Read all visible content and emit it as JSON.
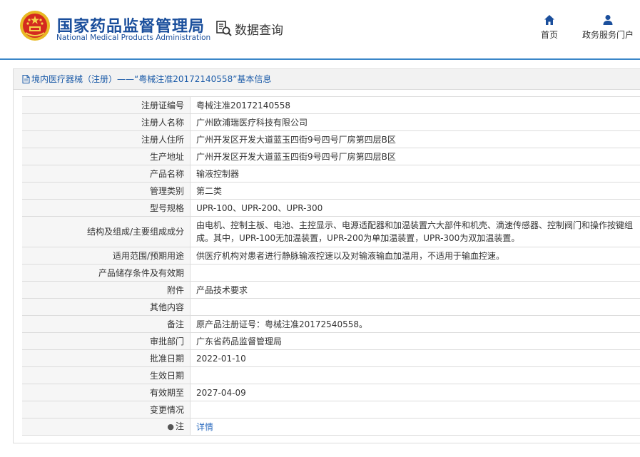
{
  "header": {
    "org_name_cn": "国家药品监督管理局",
    "org_name_en": "National Medical Products Administration",
    "data_query_label": "数据查询",
    "nav": [
      {
        "label": "首页",
        "icon": "home-icon"
      },
      {
        "label": "政务服务门户",
        "icon": "user-icon"
      }
    ]
  },
  "breadcrumb": {
    "text": "境内医疗器械（注册）——“粤械注准20172140558”基本信息",
    "icon": "document-icon"
  },
  "details": [
    {
      "label": "注册证编号",
      "value": "粤械注准20172140558"
    },
    {
      "label": "注册人名称",
      "value": "广州欧浦瑞医疗科技有限公司"
    },
    {
      "label": "注册人住所",
      "value": "广州开发区开发大道蓝玉四街9号四号厂房第四层B区"
    },
    {
      "label": "生产地址",
      "value": "广州开发区开发大道蓝玉四街9号四号厂房第四层B区"
    },
    {
      "label": "产品名称",
      "value": "输液控制器"
    },
    {
      "label": "管理类别",
      "value": "第二类"
    },
    {
      "label": "型号规格",
      "value": "UPR-100、UPR-200、UPR-300"
    },
    {
      "label": "结构及组成/主要组成成分",
      "value": "由电机、控制主板、电池、主控显示、电源适配器和加温装置六大部件和机壳、滴速传感器、控制阀门和操作按键组成。其中，UPR-100无加温装置，UPR-200为单加温装置，UPR-300为双加温装置。"
    },
    {
      "label": "适用范围/预期用途",
      "value": "供医疗机构对患者进行静脉输液控速以及对输液输血加温用，不适用于输血控速。"
    },
    {
      "label": "产品储存条件及有效期",
      "value": ""
    },
    {
      "label": "附件",
      "value": "产品技术要求"
    },
    {
      "label": "其他内容",
      "value": ""
    },
    {
      "label": "备注",
      "value": "原产品注册证号：粤械注准20172540558。"
    },
    {
      "label": "审批部门",
      "value": "广东省药品监督管理局"
    },
    {
      "label": "批准日期",
      "value": "2022-01-10"
    },
    {
      "label": "生效日期",
      "value": ""
    },
    {
      "label": "有效期至",
      "value": "2027-04-09"
    },
    {
      "label": "变更情况",
      "value": ""
    }
  ],
  "note_row": {
    "label": "注",
    "icon": "lightbulb-icon",
    "link_text": "详情"
  },
  "colors": {
    "brand_blue": "#1b4f9c",
    "header_line": "#3a86c8",
    "link_blue": "#2b6bbf",
    "label_bg": "#f6f6f6"
  }
}
